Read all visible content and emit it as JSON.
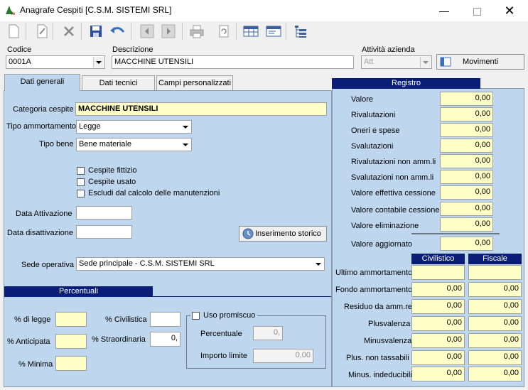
{
  "window": {
    "title": "Anagrafe Cespiti [C.S.M. SISTEMI SRL]"
  },
  "header": {
    "codice_label": "Codice",
    "codice_value": "0001A",
    "descrizione_label": "Descrizione",
    "descrizione_value": "MACCHINE UTENSILI",
    "attivita_label": "Attività azienda",
    "attivita_value": "Att",
    "movimenti_label": "Movimenti"
  },
  "tabs": [
    "Dati generali",
    "Dati tecnici",
    "Campi personalizzati"
  ],
  "general": {
    "categoria_label": "Categoria cespite",
    "categoria_value": "MACCHINE UTENSILI",
    "tipo_ammortamento_label": "Tipo ammortamento",
    "tipo_ammortamento_value": "Legge",
    "tipo_bene_label": "Tipo bene",
    "tipo_bene_value": "Bene materiale",
    "check_fittizio": "Cespite fittizio",
    "check_usato": "Cespite usato",
    "check_escludi": "Escludi dal calcolo delle manutenzioni",
    "data_attivazione_label": "Data Attivazione",
    "data_disattivazione_label": "Data disattivazione",
    "inserimento_storico": "Inserimento storico",
    "sede_label": "Sede operativa",
    "sede_value": "Sede principale - C.S.M. SISTEMI SRL"
  },
  "percentuali": {
    "header": "Percentuali",
    "di_legge": "% di legge",
    "anticipata": "% Anticipata",
    "minima": "% Minima",
    "civilistica": "% Civilistica",
    "straordinaria": "% Straordinaria",
    "straordinaria_value": "0,",
    "uso_promiscuo": "Uso promiscuo",
    "percentuale_label": "Percentuale",
    "percentuale_value": "0,",
    "importo_label": "Importo limite",
    "importo_value": "0,00"
  },
  "registro": {
    "header": "Registro",
    "rows": [
      {
        "label": "Valore",
        "value": "0,00"
      },
      {
        "label": "Rivalutazioni",
        "value": "0,00"
      },
      {
        "label": "Oneri e spese",
        "value": "0,00"
      },
      {
        "label": "Svalutazioni",
        "value": "0,00"
      },
      {
        "label": "Rivalutazioni non amm.li",
        "value": "0,00"
      },
      {
        "label": "Svalutazioni non amm.li",
        "value": "0,00"
      },
      {
        "label": "Valore effettiva cessione",
        "value": "0,00"
      },
      {
        "label": "Valore contabile cessione",
        "value": "0,00"
      },
      {
        "label": "Valore eliminazione",
        "value": "0,00"
      }
    ],
    "aggiornato_label": "Valore aggiornato",
    "aggiornato_value": "0,00",
    "col_civ": "Civilistico",
    "col_fis": "Fiscale",
    "rows2": [
      {
        "label": "Ultimo ammortamento",
        "civ": "",
        "fis": ""
      },
      {
        "label": "Fondo ammortamento",
        "civ": "0,00",
        "fis": "0,00"
      },
      {
        "label": "Residuo da amm.re",
        "civ": "0,00",
        "fis": "0,00"
      },
      {
        "label": "Plusvalenza",
        "civ": "0,00",
        "fis": "0,00"
      },
      {
        "label": "Minusvalenza",
        "civ": "0,00",
        "fis": "0,00"
      },
      {
        "label": "Plus. non tassabili",
        "civ": "0,00",
        "fis": "0,00"
      },
      {
        "label": "Minus. indeducibili",
        "civ": "0,00",
        "fis": "0,00"
      }
    ]
  },
  "icons": [
    "new-icon",
    "edit-icon",
    "delete-icon",
    "save-icon",
    "undo-icon",
    "prev-icon",
    "next-icon",
    "print-icon",
    "refresh-icon",
    "grid-icon",
    "form-icon",
    "tree-icon"
  ]
}
